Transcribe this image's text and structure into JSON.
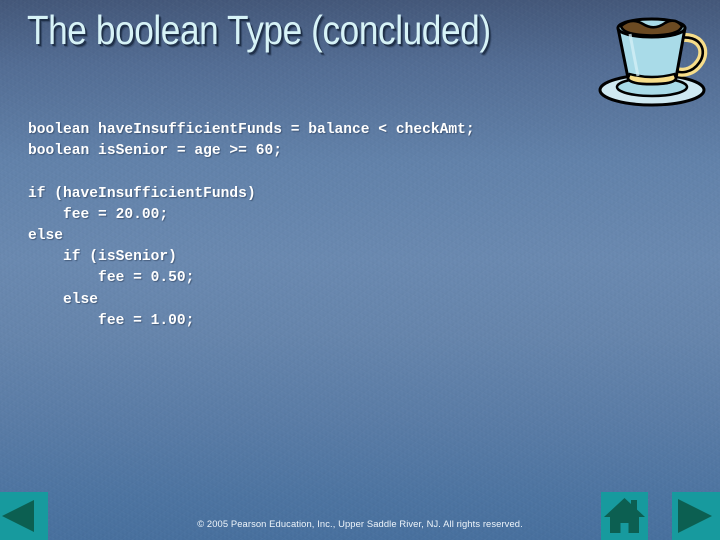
{
  "slide": {
    "title": "The boolean Type (concluded)",
    "background_color": "#6685ac",
    "title_color": "#d7f3f7"
  },
  "code": {
    "language": "java",
    "text": "boolean haveInsufficientFunds = balance < checkAmt;\nboolean isSenior = age >= 60;\n\nif (haveInsufficientFunds)\n    fee = 20.00;\nelse\n    if (isSenior)\n        fee = 0.50;\n    else\n        fee = 1.00;",
    "lines": [
      "boolean haveInsufficientFunds = balance < checkAmt;",
      "boolean isSenior = age >= 60;",
      "",
      "if (haveInsufficientFunds)",
      "    fee = 20.00;",
      "else",
      "    if (isSenior)",
      "        fee = 0.50;",
      "    else",
      "        fee = 1.00;"
    ],
    "text_color": "#ffffff"
  },
  "footer": {
    "copyright": "© 2005 Pearson Education, Inc., Upper Saddle River, NJ.  All rights reserved."
  },
  "nav": {
    "previous_label": "Previous slide",
    "home_label": "Home",
    "next_label": "Next slide",
    "button_color": "#179a9e",
    "glyph_color": "#0c5f51"
  },
  "decor": {
    "cup_label": "coffee-cup-clipart",
    "cup_body_color": "#a9dbe8",
    "cup_handle_color": "#f6dd8a",
    "coffee_color": "#6b4a22",
    "outline_color": "#000000"
  }
}
